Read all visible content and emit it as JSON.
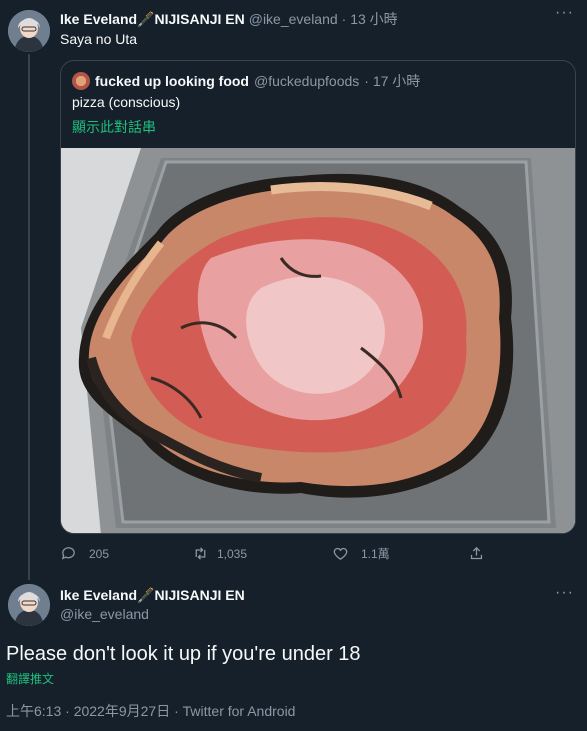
{
  "tweet": {
    "display_name": "Ike Eveland🖋️NIJISANJI EN",
    "handle": "@ike_eveland",
    "time": "· 13 小時",
    "text": "Saya no Uta",
    "quoted": {
      "display_name": "fucked up looking food",
      "handle": "@fuckedupfoods",
      "time": "· 17 小時",
      "text": "pizza (conscious)",
      "show_thread": "顯示此對話串"
    },
    "actions": {
      "replies": "205",
      "retweets": "1,035",
      "likes": "1.1萬"
    }
  },
  "reply": {
    "display_name": "Ike Eveland🖋️NIJISANJI EN",
    "handle": "@ike_eveland",
    "text": "Please don't look it up if you're under 18",
    "translate": "翻譯推文",
    "meta": "上午6:13 · 2022年9月27日 · Twitter for Android"
  },
  "icons": [
    "more-icon",
    "reply-icon",
    "retweet-icon",
    "like-icon",
    "share-icon"
  ],
  "colors": {
    "background": "#15202b",
    "muted": "#8b98a5",
    "link_green": "#1dbf7c",
    "border": "#38444d"
  }
}
